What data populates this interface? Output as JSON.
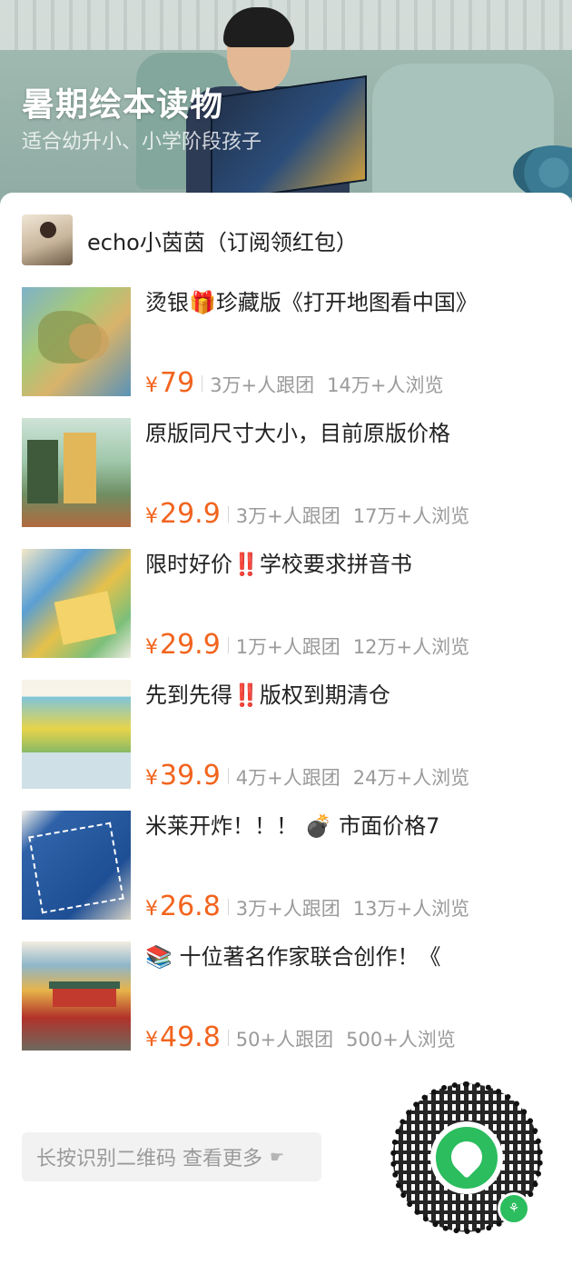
{
  "hero": {
    "title": "暑期绘本读物",
    "subtitle": "适合幼升小、小学阶段孩子"
  },
  "author": {
    "name": "echo小茵茵（订阅领红包）"
  },
  "currency_symbol": "¥",
  "products": [
    {
      "title": "烫银🎁珍藏版《打开地图看中国》",
      "price": "79",
      "joined": "3万+人跟团",
      "views": "14万+人浏览"
    },
    {
      "title": "原版同尺寸大小，目前原版价格",
      "price": "29.9",
      "joined": "3万+人跟团",
      "views": "17万+人浏览"
    },
    {
      "title": "限时好价‼️学校要求拼音书",
      "price": "29.9",
      "joined": "1万+人跟团",
      "views": "12万+人浏览"
    },
    {
      "title": "先到先得‼️版权到期清仓 ",
      "price": "39.9",
      "joined": "4万+人跟团",
      "views": "24万+人浏览"
    },
    {
      "title": "米莱开炸！！！ 💣 市面价格7",
      "price": "26.8",
      "joined": "3万+人跟团",
      "views": "13万+人浏览"
    },
    {
      "title": "📚 十位著名作家联合创作！《",
      "price": "49.8",
      "joined": "50+人跟团",
      "views": "500+人浏览"
    }
  ],
  "footer": {
    "more_label": "长按识别二维码 查看更多"
  },
  "colors": {
    "price": "#f2641e",
    "stat": "#9a9a9a",
    "miniprogram_green": "#2bbd5e"
  },
  "icons": {
    "more_arrow": "pointing-hand-icon",
    "qr_badge": "wechat-miniprogram-icon"
  }
}
